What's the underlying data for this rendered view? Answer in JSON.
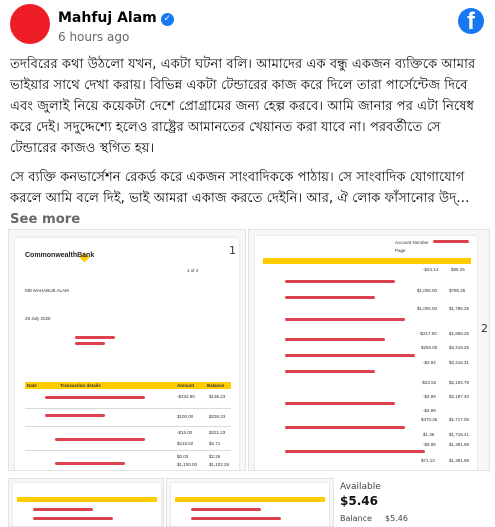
{
  "post": {
    "author": "Mahfuj Alam",
    "time": "6 hours ago",
    "paragraph1": "তদবিরের কথা উঠলো যখন, একটা ঘটনা বলি। আমাদের এক বন্ধু একজন ব্যক্তিকে আমার ভাইয়ার সাথে দেখা করায়। বিভিন্ন একটা টেন্ডারের কাজ করে দিলে তারা পার্সেন্টেজ দিবে এবং জুলাই নিয়ে কয়েকটা দেশে প্রোগ্রামের জন্য হেল্প করবে। আমি জানার পর এটা নিষেধ করে দেই। সদুদ্দেশ্যে হলেও রাষ্ট্রের আমানতের খেয়ানত করা যাবে না। পরবর্তীতে সে টেন্ডারের কাজও স্থগিত হয়।",
    "paragraph2": "সে ব্যক্তি কনভার্সেশন রেকর্ড করে একজন সাংবাদিককে পাঠায়। সে সাংবাদিক যোগাযোগ করলে আমি বলে দিই, ভাই আমরা একাজ করতে দেইনি। আর, ঐ লোক ফাঁসানোর উদ্…",
    "see_more": "See more"
  },
  "brand": {
    "logo_letter": "f",
    "brand_color": "#1877f2",
    "avatar_color": "#ee1c24"
  },
  "icons": {
    "verified": "verified-badge-icon",
    "facebook": "facebook-logo-icon"
  },
  "statement1": {
    "bank_name": "CommonwealthBank",
    "page": "1 of 4",
    "page_number": "1",
    "account_name": "MD MAHABUB ALAM",
    "date": "29 July 2025",
    "columns": [
      "Date",
      "Transaction details",
      "Amount",
      "Balance"
    ],
    "amounts": [
      "-$233.90",
      "$100.00",
      "-$15.00",
      "$218.52",
      "$0.03",
      "$1,100.00"
    ],
    "balances": [
      "$136.23",
      "$236.23",
      "$221.23",
      "$2.71",
      "$2.26",
      "$1,102.26"
    ]
  },
  "statement2": {
    "page_number": "2",
    "page_label": "Page",
    "account_label": "Account Number",
    "amounts": [
      "-$24.14",
      "$1,000.00",
      "$1,000.00",
      "-$217.00",
      "$250.00",
      "-$2.94",
      "-$22.52",
      "-$4.99",
      "-$4.99",
      "$470.35",
      "$1.36",
      "-$5.95",
      "$71.13"
    ],
    "balances": [
      "$86.25",
      "$786.25",
      "$1,786.25",
      "$1,969.25",
      "$2,219.25",
      "$2,216.31",
      "$2,193.79",
      "$2,187.40",
      "$1,717.05",
      "$1,718.41",
      "$1,391.98",
      "$1,391.98",
      "$1,391.98"
    ]
  },
  "side_panel": {
    "available_label": "Available",
    "available_amount": "$5.46",
    "balance_label": "Balance",
    "balance_amount": "$5.46"
  }
}
